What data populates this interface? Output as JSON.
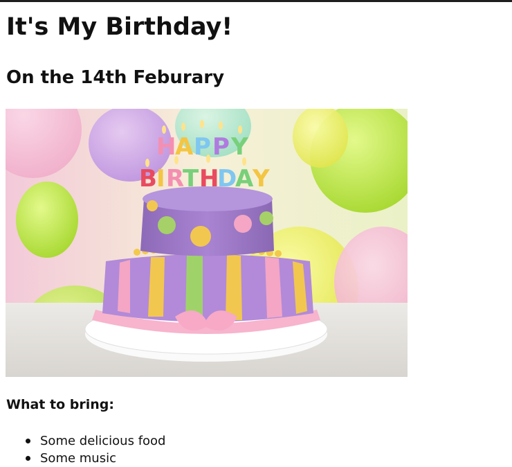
{
  "heading": "It's My Birthday!",
  "subheading": "On the 14th Feburary",
  "image": {
    "cake_topper_line1": "HAPPY",
    "cake_topper_line2": "BIRTHDAY"
  },
  "bring_heading": "What to bring:",
  "bring_items": [
    "Some delicious food",
    "Some music"
  ]
}
